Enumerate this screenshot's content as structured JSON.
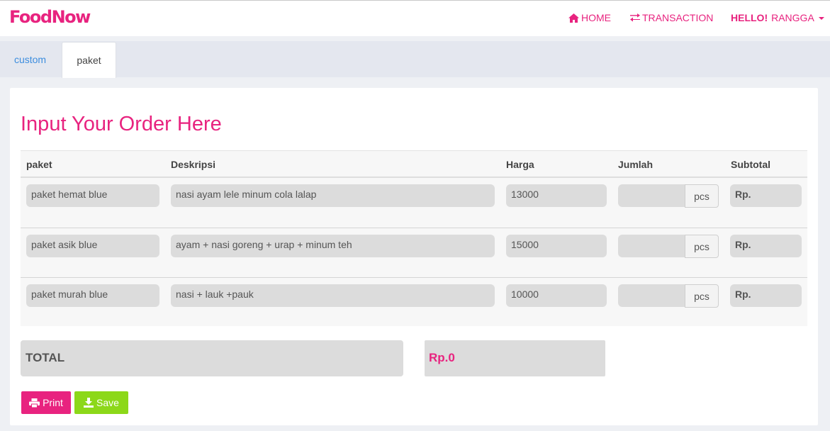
{
  "brand": "FoodNow",
  "nav": {
    "home": "HOME",
    "transaction": "TRANSACTION",
    "hello": "HELLO!",
    "user": "RANGGA"
  },
  "tabs": [
    "custom",
    "paket"
  ],
  "active_tab": "paket",
  "page_title": "Input Your Order Here",
  "table": {
    "headers": [
      "paket",
      "Deskripsi",
      "Harga",
      "Jumlah",
      "Subtotal"
    ],
    "rows": [
      {
        "paket": "paket hemat blue",
        "deskripsi": "nasi ayam lele minum cola lalap",
        "harga": "13000",
        "jumlah": "",
        "unit": "pcs",
        "subtotal": "Rp."
      },
      {
        "paket": "paket asik blue",
        "deskripsi": "ayam + nasi goreng + urap + minum teh",
        "harga": "15000",
        "jumlah": "",
        "unit": "pcs",
        "subtotal": "Rp."
      },
      {
        "paket": "paket murah blue",
        "deskripsi": "nasi + lauk +pauk",
        "harga": "10000",
        "jumlah": "",
        "unit": "pcs",
        "subtotal": "Rp."
      }
    ]
  },
  "total": {
    "label": "TOTAL",
    "value": "Rp.0"
  },
  "buttons": {
    "print": "Print",
    "save": "Save"
  },
  "colors": {
    "brand": "#e8237f",
    "save": "#8cd819",
    "tab_link": "#3c8dde"
  }
}
